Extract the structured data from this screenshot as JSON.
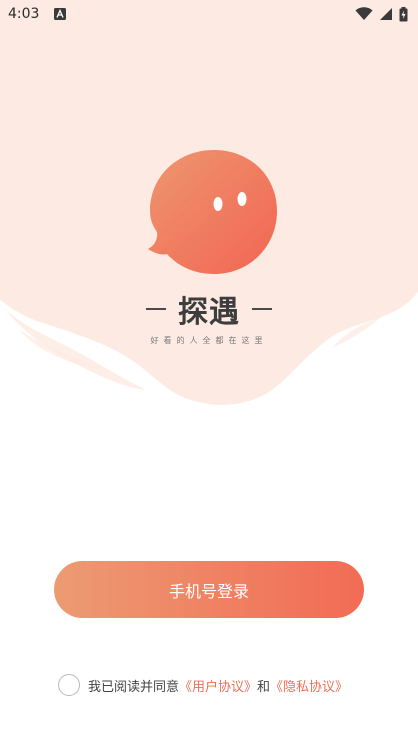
{
  "status_bar": {
    "time": "4:03",
    "icons": [
      "notification-a-icon",
      "wifi-icon",
      "signal-icon",
      "battery-charging-icon"
    ]
  },
  "brand": {
    "name": "探遇",
    "slogan": "好看的人全都在这里"
  },
  "login": {
    "button_label": "手机号登录"
  },
  "agreement": {
    "prefix": "我已阅读并同意",
    "user_agreement": "《用户协议》",
    "conjunction": "和",
    "privacy_agreement": "《隐私协议》",
    "checked": false
  },
  "colors": {
    "accent": "#f26b55",
    "gradient_start": "#ec9b72",
    "gradient_end": "#f26b55",
    "header_bg": "#fdebe3"
  }
}
